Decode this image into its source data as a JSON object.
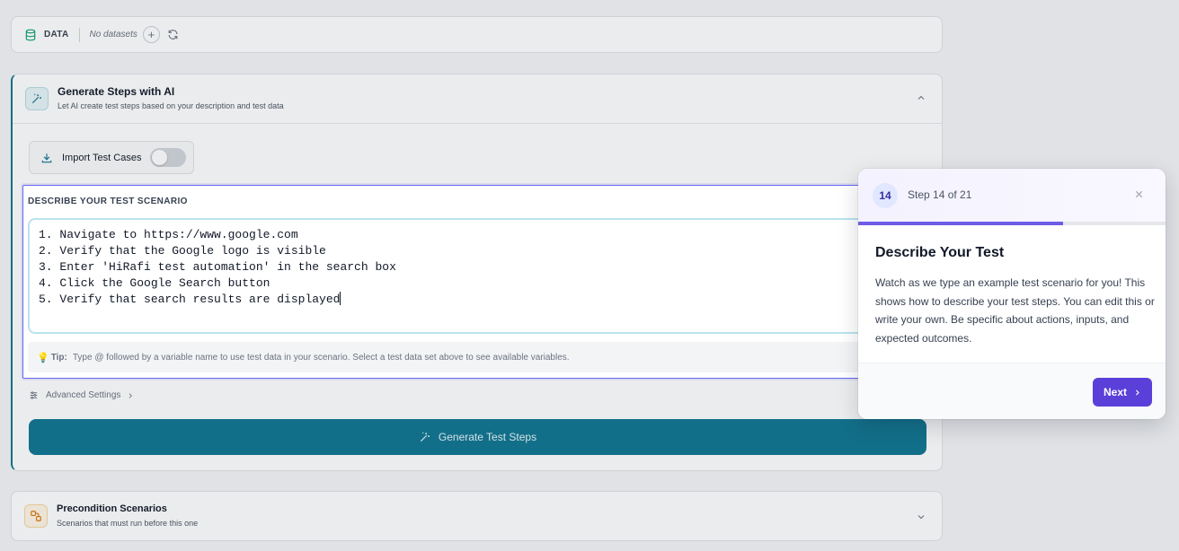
{
  "databar": {
    "label": "DATA",
    "empty_text": "No datasets",
    "add_symbol": "+"
  },
  "generate": {
    "title": "Generate Steps with AI",
    "subtitle": "Let AI create test steps based on your description and test data",
    "import_label": "Import Test Cases",
    "import_enabled": false,
    "advanced_label": "Advanced Settings",
    "button_label": "Generate Test Steps"
  },
  "scenario": {
    "label": "DESCRIBE YOUR TEST SCENARIO",
    "lines": [
      "1. Navigate to https://www.google.com",
      "2. Verify that the Google logo is visible",
      "3. Enter 'HiRafi test automation' in the search box",
      "4. Click the Google Search button",
      "5. Verify that search results are displayed"
    ],
    "tip_label": "Tip:",
    "tip_text": "Type @ followed by a variable name to use test data in your scenario. Select a test data set above to see available variables."
  },
  "precondition": {
    "title": "Precondition Scenarios",
    "subtitle": "Scenarios that must run before this one"
  },
  "tour": {
    "step_number": "14",
    "step_text": "Step 14 of 21",
    "progress_fraction": 0.667,
    "title": "Describe Your Test",
    "body": "Watch as we type an example test scenario for you! This shows how to describe your test steps. You can edit this or write your own. Be specific about actions, inputs, and expected outcomes.",
    "next_label": "Next"
  },
  "colors": {
    "accent": "#0e7490",
    "tour_accent": "#5b3fd9",
    "highlight_border": "#6366f1"
  }
}
